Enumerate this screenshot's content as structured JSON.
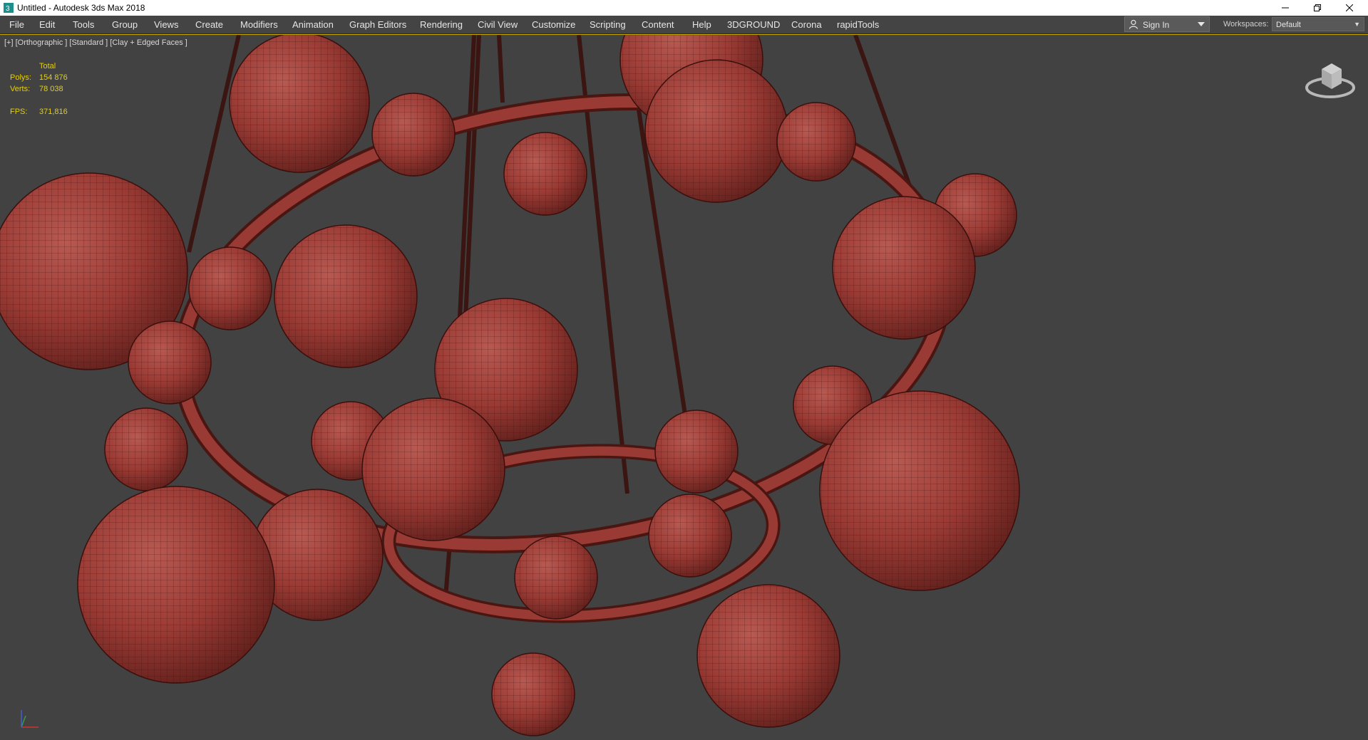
{
  "window": {
    "title": "Untitled - Autodesk 3ds Max 2018",
    "app_icon": "3dsmax-icon",
    "controls": [
      "minimize-icon",
      "restore-icon",
      "close-icon"
    ]
  },
  "menubar": {
    "items": [
      "File",
      "Edit",
      "Tools",
      "Group",
      "Views",
      "Create",
      "Modifiers",
      "Animation",
      "Graph Editors",
      "Rendering",
      "Civil View",
      "Customize",
      "Scripting",
      "Content",
      "Help",
      "3DGROUND",
      "Corona",
      "rapidTools"
    ]
  },
  "signin": {
    "label": "Sign In",
    "icon": "person-icon"
  },
  "workspaces": {
    "label": "Workspaces:",
    "value": "Default"
  },
  "viewport": {
    "label": "[+] [Orthographic ] [Standard ] [Clay + Edged Faces ]",
    "stats": {
      "header": "Total",
      "polys_label": "Polys:",
      "polys": "154 876",
      "verts_label": "Verts:",
      "verts": "78 038",
      "fps_label": "FPS:",
      "fps": "371,816"
    },
    "colors": {
      "background": "#424242",
      "clay": "#9c3a34",
      "stats_text": "#e6d000"
    }
  }
}
